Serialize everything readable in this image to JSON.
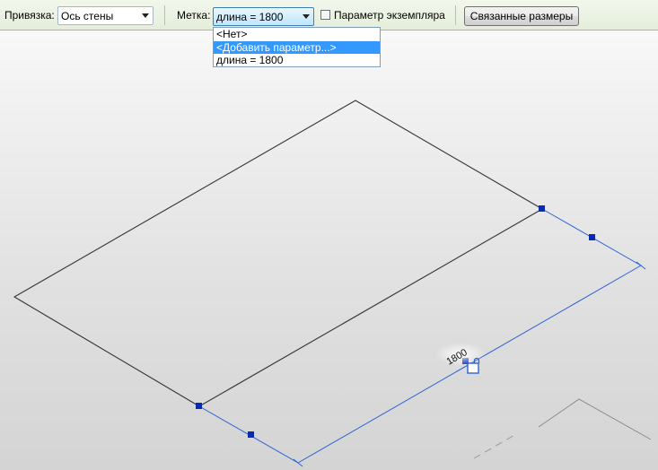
{
  "options_bar": {
    "snap_label": "Привязка:",
    "snap_value": "Ось стены",
    "tag_label": "Метка:",
    "tag_value": "длина = 1800",
    "instance_param_label": "Параметр экземпляра",
    "instance_param_checked": false,
    "linked_dims_button": "Связанные размеры"
  },
  "tag_dropdown": {
    "items": [
      "<Нет>",
      "<Добавить параметр...>",
      "длина = 1800"
    ],
    "highlighted_index": 1
  },
  "canvas": {
    "dimension_text": "1800",
    "colors": {
      "geometry": "#333333",
      "dimension": "#2b62d6",
      "grip": "#0a2bb0",
      "selection_highlight": "#3399ff"
    }
  }
}
